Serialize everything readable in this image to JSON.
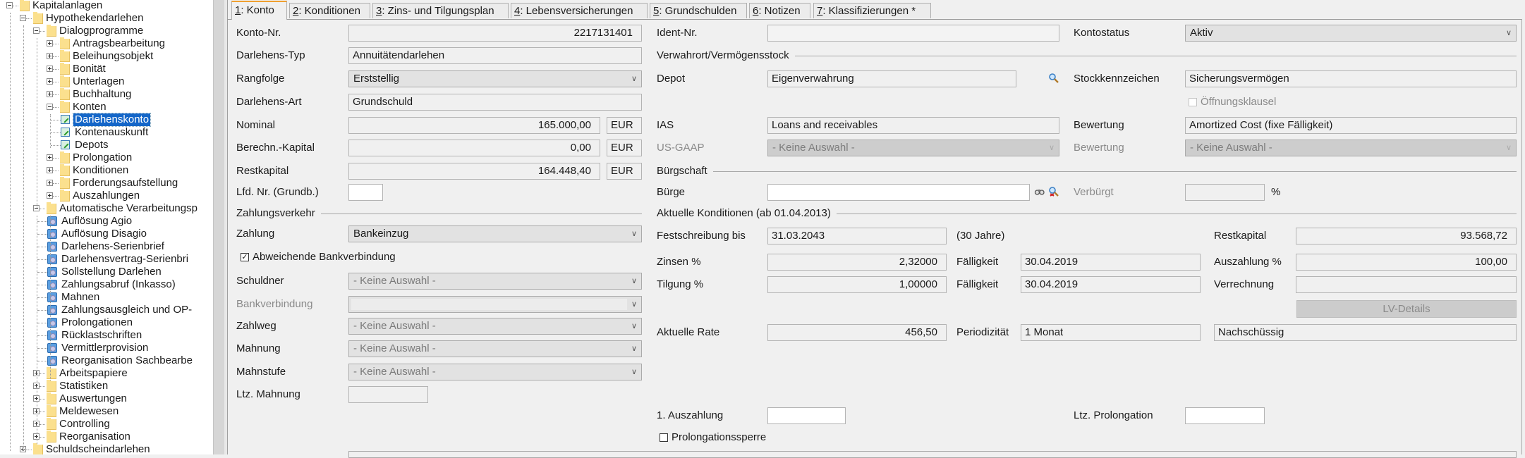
{
  "tree": [
    {
      "label": "Kapitalanlagen",
      "level": 0,
      "type": "folder",
      "expanded": true
    },
    {
      "label": "Hypothekendarlehen",
      "level": 1,
      "type": "folder",
      "expanded": true
    },
    {
      "label": "Dialogprogramme",
      "level": 2,
      "type": "folder",
      "expanded": true
    },
    {
      "label": "Antragsbearbeitung",
      "level": 3,
      "type": "folder",
      "expanded": false
    },
    {
      "label": "Beleihungsobjekt",
      "level": 3,
      "type": "folder",
      "expanded": false
    },
    {
      "label": "Bonität",
      "level": 3,
      "type": "folder",
      "expanded": false
    },
    {
      "label": "Unterlagen",
      "level": 3,
      "type": "folder",
      "expanded": false
    },
    {
      "label": "Buchhaltung",
      "level": 3,
      "type": "folder",
      "expanded": false
    },
    {
      "label": "Konten",
      "level": 3,
      "type": "folder",
      "expanded": true
    },
    {
      "label": "Darlehenskonto",
      "level": 4,
      "type": "doc",
      "selected": true
    },
    {
      "label": "Kontenauskunft",
      "level": 4,
      "type": "doc"
    },
    {
      "label": "Depots",
      "level": 4,
      "type": "doc"
    },
    {
      "label": "Prolongation",
      "level": 3,
      "type": "folder",
      "expanded": false
    },
    {
      "label": "Konditionen",
      "level": 3,
      "type": "folder",
      "expanded": false
    },
    {
      "label": "Forderungsaufstellung",
      "level": 3,
      "type": "folder",
      "expanded": false
    },
    {
      "label": "Auszahlungen",
      "level": 3,
      "type": "folder",
      "expanded": false
    },
    {
      "label": "Automatische Verarbeitungsp",
      "level": 2,
      "type": "folder",
      "expanded": true
    },
    {
      "label": "Auflösung Agio",
      "level": 3,
      "type": "job"
    },
    {
      "label": "Auflösung Disagio",
      "level": 3,
      "type": "job"
    },
    {
      "label": "Darlehens-Serienbrief",
      "level": 3,
      "type": "job"
    },
    {
      "label": "Darlehensvertrag-Serienbri",
      "level": 3,
      "type": "job"
    },
    {
      "label": "Sollstellung Darlehen",
      "level": 3,
      "type": "job"
    },
    {
      "label": "Zahlungsabruf (Inkasso)",
      "level": 3,
      "type": "job"
    },
    {
      "label": "Mahnen",
      "level": 3,
      "type": "job"
    },
    {
      "label": "Zahlungsausgleich und OP-",
      "level": 3,
      "type": "job"
    },
    {
      "label": "Prolongationen",
      "level": 3,
      "type": "job"
    },
    {
      "label": "Rücklastschriften",
      "level": 3,
      "type": "job"
    },
    {
      "label": "Vermittlerprovision",
      "level": 3,
      "type": "job"
    },
    {
      "label": "Reorganisation Sachbearbe",
      "level": 3,
      "type": "job"
    },
    {
      "label": "Arbeitspapiere",
      "level": 2,
      "type": "folder",
      "expanded": false
    },
    {
      "label": "Statistiken",
      "level": 2,
      "type": "folder",
      "expanded": false
    },
    {
      "label": "Auswertungen",
      "level": 2,
      "type": "folder",
      "expanded": false
    },
    {
      "label": "Meldewesen",
      "level": 2,
      "type": "folder",
      "expanded": false
    },
    {
      "label": "Controlling",
      "level": 2,
      "type": "folder",
      "expanded": false
    },
    {
      "label": "Reorganisation",
      "level": 2,
      "type": "folder",
      "expanded": false
    },
    {
      "label": "Schuldscheindarlehen",
      "level": 1,
      "type": "folder",
      "expanded": false
    }
  ],
  "tabs": [
    {
      "mnemonic": "1",
      "label": ": Konto",
      "active": true
    },
    {
      "mnemonic": "2",
      "label": ": Konditionen"
    },
    {
      "mnemonic": "3",
      "label": ": Zins- und Tilgungsplan"
    },
    {
      "mnemonic": "4",
      "label": ": Lebensversicherungen"
    },
    {
      "mnemonic": "5",
      "label": ": Grundschulden"
    },
    {
      "mnemonic": "6",
      "label": ": Notizen"
    },
    {
      "mnemonic": "7",
      "label": ": Klassifizierungen *"
    }
  ],
  "form": {
    "konto_nr": {
      "label": "Konto-Nr.",
      "value": "2217131401"
    },
    "darlehens_typ": {
      "label": "Darlehens-Typ",
      "value": "Annuitätendarlehen"
    },
    "rangfolge": {
      "label": "Rangfolge",
      "value": "Erststellig"
    },
    "darlehens_art": {
      "label": "Darlehens-Art",
      "value": "Grundschuld"
    },
    "nominal": {
      "label": "Nominal",
      "value": "165.000,00",
      "currency": "EUR"
    },
    "berechn_kapital": {
      "label": "Berechn.-Kapital",
      "value": "0,00",
      "currency": "EUR"
    },
    "restkapital": {
      "label": "Restkapital",
      "value": "164.448,40",
      "currency": "EUR"
    },
    "lfd_nr": {
      "label": "Lfd. Nr. (Grundb.)",
      "value": ""
    },
    "zahlungsverkehr": {
      "title": "Zahlungsverkehr"
    },
    "zahlung": {
      "label": "Zahlung",
      "value": "Bankeinzug"
    },
    "abweichende_bankverbindung": {
      "label": "Abweichende Bankverbindung",
      "checked": true
    },
    "schuldner": {
      "label": "Schuldner",
      "value": "- Keine Auswahl -"
    },
    "bankverbindung": {
      "label": "Bankverbindung",
      "value": ""
    },
    "zahlweg": {
      "label": "Zahlweg",
      "value": "- Keine Auswahl -"
    },
    "mahnung": {
      "label": "Mahnung",
      "value": "- Keine Auswahl -"
    },
    "mahnstufe": {
      "label": "Mahnstufe",
      "value": "- Keine Auswahl -"
    },
    "ltz_mahnung": {
      "label": "Ltz. Mahnung",
      "value": ""
    },
    "ident_nr": {
      "label": "Ident-Nr.",
      "value": ""
    },
    "kontostatus": {
      "label": "Kontostatus",
      "value": "Aktiv"
    },
    "verwahrort": {
      "title": "Verwahrort/Vermögensstock"
    },
    "depot": {
      "label": "Depot",
      "value": "Eigenverwahrung"
    },
    "stockkennzeichen": {
      "label": "Stockkennzeichen",
      "value": "Sicherungsvermögen"
    },
    "oeffnungsklausel": {
      "label": "Öffnungsklausel",
      "checked": false
    },
    "ias": {
      "label": "IAS",
      "value": "Loans and receivables"
    },
    "bewertung_ias": {
      "label": "Bewertung",
      "value": "Amortized Cost (fixe Fälligkeit)"
    },
    "us_gaap": {
      "label": "US-GAAP",
      "value": "- Keine Auswahl -"
    },
    "bewertung_gaap": {
      "label": "Bewertung",
      "value": "- Keine Auswahl -"
    },
    "buergschaft": {
      "title": "Bürgschaft"
    },
    "buerge": {
      "label": "Bürge",
      "value": ""
    },
    "verbuergt": {
      "label": "Verbürgt",
      "value": "",
      "unit": "%"
    },
    "aktuelle_konditionen": {
      "title": "Aktuelle Konditionen (ab 01.04.2013)"
    },
    "festschreibung": {
      "label": "Festschreibung bis",
      "value": "31.03.2043",
      "note": "(30 Jahre)"
    },
    "restkapital_akt": {
      "label": "Restkapital",
      "value": "93.568,72"
    },
    "zinsen": {
      "label": "Zinsen %",
      "value": "2,32000",
      "faelligkeit_label": "Fälligkeit",
      "faelligkeit": "30.04.2019"
    },
    "auszahlung_pct": {
      "label": "Auszahlung %",
      "value": "100,00"
    },
    "tilgung": {
      "label": "Tilgung %",
      "value": "1,00000",
      "faelligkeit_label": "Fälligkeit",
      "faelligkeit": "30.04.2019"
    },
    "verrechnung": {
      "label": "Verrechnung",
      "value": ""
    },
    "lv_details": {
      "label": "LV-Details"
    },
    "aktuelle_rate": {
      "label": "Aktuelle Rate",
      "value": "456,50"
    },
    "periodizitaet": {
      "label": "Periodizität",
      "value": "1 Monat"
    },
    "zahlungsart": {
      "value": "Nachschüssig"
    },
    "erste_auszahlung": {
      "label": "1. Auszahlung",
      "value": ""
    },
    "ltz_prolongation": {
      "label": "Ltz. Prolongation",
      "value": ""
    },
    "prolongationssperre": {
      "label": "Prolongationssperre",
      "checked": false
    }
  },
  "colors": {
    "selection": "#1466c8",
    "active_tab_accent": "#f0a030",
    "folder": "#fbe08e"
  }
}
